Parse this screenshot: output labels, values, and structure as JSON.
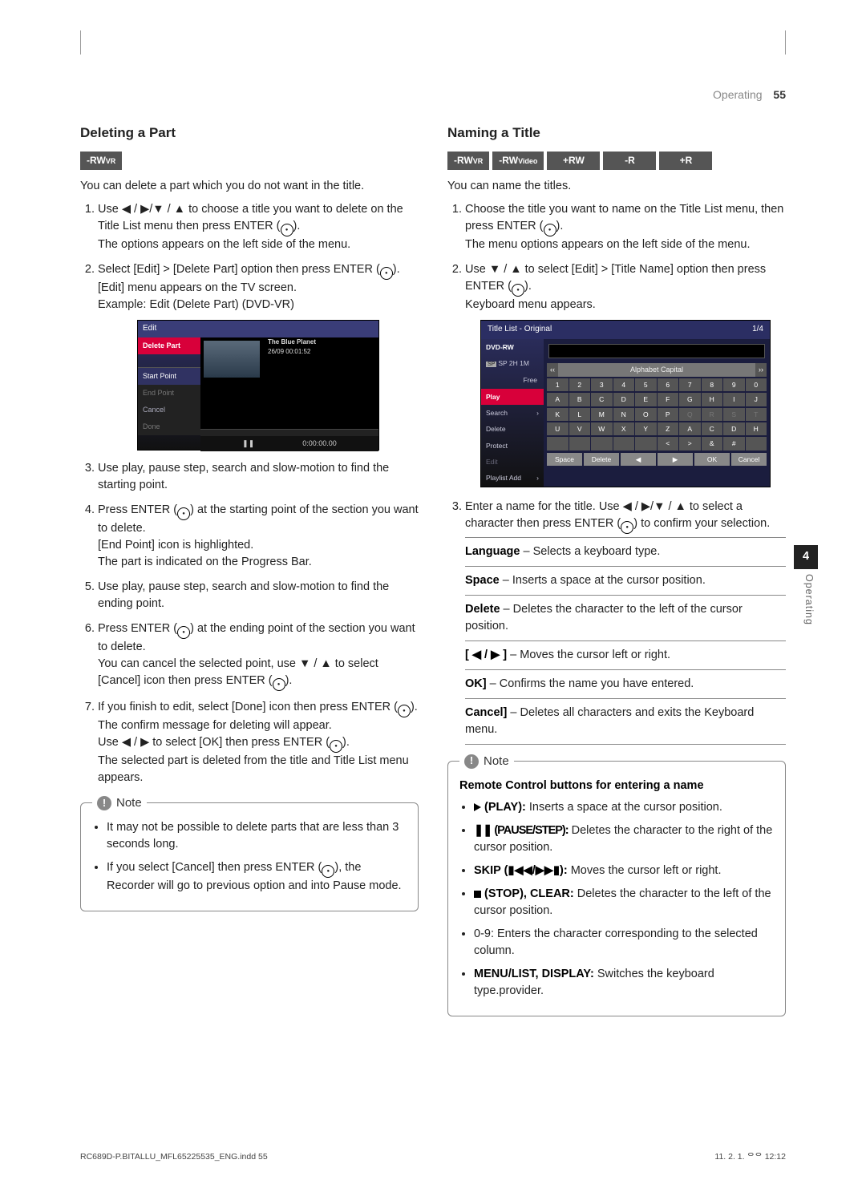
{
  "header": {
    "section": "Operating",
    "page": "55"
  },
  "left": {
    "heading": "Deleting a Part",
    "tags": [
      "-RW"
    ],
    "tagsub": [
      "VR"
    ],
    "intro": "You can delete a part which you do not want in the title.",
    "li1a": "Use ",
    "li1b": " to choose a title you want to delete on the Title List menu then press ENTER (",
    "li1c": ").",
    "li1d": "The options appears on the left side of the menu.",
    "li2a": "Select [Edit] > [Delete Part] option then press ENTER (",
    "li2b": ").",
    "li2c": "[Edit] menu appears on the TV screen.",
    "li2d": "Example: Edit (Delete Part) (DVD-VR)",
    "shot1": {
      "header": "Edit",
      "side": [
        "Delete Part",
        "",
        "",
        "Start Point",
        "End Point",
        "Cancel",
        "Done"
      ],
      "caption1": "The Blue Planet",
      "caption2": "26/09  00:01:52",
      "pause": "❚❚",
      "time": "0:00:00.00"
    },
    "li3": "Use play, pause step, search and slow-motion to find the starting point.",
    "li4a": "Press ENTER (",
    "li4b": ") at the starting point of the section you want to delete.",
    "li4c": "[End Point] icon is highlighted.",
    "li4d": "The part is indicated on the Progress Bar.",
    "li5": "Use play, pause step, search and slow-motion to find the ending point.",
    "li6a": "Press ENTER (",
    "li6b": ") at the ending point of the section you want to delete.",
    "li6c": "You can cancel the selected point, use ",
    "li6d": " to select [Cancel] icon then press ENTER (",
    "li6e": ").",
    "li7a": "If you finish to edit, select [Done] icon then press ENTER (",
    "li7b": ").",
    "li7c": "The confirm message for deleting will appear.",
    "li7d": "Use ",
    "li7e": " to select [OK] then press ENTER (",
    "li7f": ").",
    "li7g": "The selected part is deleted from the title and Title List menu appears.",
    "note_label": "Note",
    "note1": "It may not be possible to delete parts that are less than 3 seconds long.",
    "note2a": "If you select [Cancel] then press ENTER (",
    "note2b": "), the Recorder will go to previous option and into Pause mode."
  },
  "right": {
    "heading": "Naming a Title",
    "tags": [
      "-RW",
      "-RW",
      "+RW",
      "-R",
      "+R"
    ],
    "tagsub": [
      "VR",
      "Video",
      "",
      "",
      ""
    ],
    "intro": "You can name the titles.",
    "li1a": "Choose the title you want to name on the Title List menu, then press ENTER (",
    "li1b": ").",
    "li1c": "The menu options appears on the left side of the menu.",
    "li2a": "Use ",
    "li2b": " to select [Edit] > [Title Name] option then press ENTER (",
    "li2c": ").",
    "li2d": "Keyboard menu appears.",
    "shot2": {
      "hdrL": "Title List  -  Original",
      "hdrR": "1/4",
      "side": [
        "DVD-RW",
        "SP  2H 1M",
        "Free",
        "Play",
        "Search",
        "Delete",
        "Protect",
        "Edit",
        "Playlist Add"
      ],
      "keyhdr": "Alphabet Capital",
      "row1": [
        "1",
        "2",
        "3",
        "4",
        "5",
        "6",
        "7",
        "8",
        "9",
        "0"
      ],
      "row2": [
        "A",
        "B",
        "C",
        "D",
        "E",
        "F",
        "G",
        "H",
        "I",
        "J"
      ],
      "row3": [
        "K",
        "L",
        "M",
        "N",
        "O",
        "P",
        "Q",
        "R",
        "S",
        "T"
      ],
      "row4": [
        "U",
        "V",
        "W",
        "X",
        "Y",
        "Z",
        "A",
        "C",
        "D",
        "H"
      ],
      "row5": [
        "",
        "",
        "",
        "",
        "",
        "<",
        ">",
        "&",
        "#",
        ""
      ],
      "btns": [
        "Space",
        "Delete",
        "◀",
        "▶",
        "OK",
        "Cancel"
      ]
    },
    "li3a": "Enter a name for the title. Use ",
    "li3b": " to select a character then press ENTER (",
    "li3c": ") to confirm your selection.",
    "defs": [
      {
        "k": "Language",
        "sep": " – ",
        "v": "Selects a keyboard type."
      },
      {
        "k": "Space",
        "sep": " – ",
        "v": "Inserts a space at the cursor position."
      },
      {
        "k": "Delete",
        "sep": " – ",
        "v": "Deletes the character to the left of the cursor position."
      },
      {
        "k": "[ ◀ / ▶ ]",
        "sep": " – ",
        "v": "Moves the cursor left or right."
      },
      {
        "k": "OK]",
        "sep": " – ",
        "v": "Confirms the name you have entered."
      },
      {
        "k": "Cancel]",
        "sep": " – ",
        "v": "Deletes all characters and exits the Keyboard menu."
      }
    ],
    "note_label": "Note",
    "note_heading": "Remote Control buttons for entering a name",
    "nb1a": "(PLAY):",
    "nb1b": " Inserts a space at the cursor position.",
    "nb2a": "❚❚ (PAUSE/STEP):",
    "nb2b": " Deletes the character to the right of the cursor position.",
    "nb3a": "SKIP (▮◀◀/▶▶▮):",
    "nb3b": " Moves the cursor left or right.",
    "nb4a": " (STOP), CLEAR:",
    "nb4b": " Deletes the character to the left of the cursor position.",
    "nb5": "0-9: Enters the character corresponding to the selected column.",
    "nb6a": "MENU/LIST, DISPLAY:",
    "nb6b": " Switches the keyboard type.provider."
  },
  "sidetab": {
    "num": "4",
    "label": "Operating"
  },
  "footer": {
    "left": "RC689D-P.BITALLU_MFL65225535_ENG.indd   55",
    "right": "11. 2. 1.   ᄋᄋ 12:12"
  },
  "arrows": {
    "lrud": "◀ / ▶/▼ / ▲",
    "ud": "▼ / ▲",
    "lr": "◀ / ▶"
  }
}
